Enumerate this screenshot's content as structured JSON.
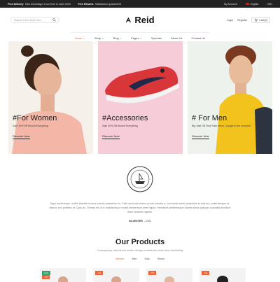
{
  "topbar": {
    "delivery_label": "Free Delivery",
    "delivery_text": "Take advantage of our time to save event",
    "returns_label": "Free Returns",
    "returns_text": "Satisfaction guaranteed",
    "account": "My Account",
    "language": "English",
    "currency": "USD"
  },
  "header": {
    "search_placeholder": "Search entire store here...",
    "logo": "Reid",
    "login": "Login",
    "register": "Register",
    "cart": "Cart(0)"
  },
  "nav": [
    "Home",
    "Shop",
    "Blog",
    "Pages",
    "Specials",
    "About Us",
    "Contact Us"
  ],
  "banners": [
    {
      "title": "#For Women",
      "subtitle": "Sale 10% Off Almost Everything",
      "link": "Discover Now"
    },
    {
      "title": "#Accessories",
      "subtitle": "Sale 40% Off Almost Everything",
      "link": "Discover Now"
    },
    {
      "title": "# For Men",
      "subtitle": "Big Sale Off Final Sale Items. Caught in the moment!",
      "link": "Discover Now"
    }
  ],
  "about": {
    "text": "Eget scelerisque, mollis blandit et risus mauris phasellus eu. Felis amet dui metus purus lobortis a, commodo amet phasellus id erat leo, pellentesque id, dictum orci porttitor et. Quis ac. Semas ed, ut in adipiscing in morbi elementum amet ligula. Hendrerit pellentesque laoreet risus quisque convallis tincidunt diam vivamus sapien.",
    "signature_name": "SILVESTER",
    "signature_role": "CEO"
  },
  "products": {
    "title": "Our Products",
    "subtitle": "Contemporary, minimal and modern designs embody the Lavish Alora handwriting",
    "tabs": [
      "Women",
      "Men",
      "Kids",
      "Shoes"
    ],
    "badges": [
      [
        "New",
        "-7%"
      ],
      [
        "-7%"
      ],
      [
        "-7%"
      ],
      [
        "-7%"
      ]
    ]
  },
  "colors": {
    "accent": "#e8673c",
    "new_badge": "#3aa06d"
  }
}
